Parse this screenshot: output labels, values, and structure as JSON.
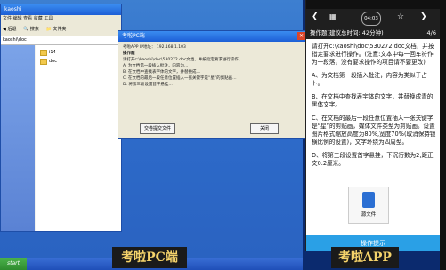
{
  "pc": {
    "explorer_title": "kaoshi",
    "menu": "文件 编辑 查看 收藏 工具",
    "toolbar_back": "后退",
    "toolbar_search": "搜索",
    "toolbar_folders": "文件夹",
    "address": "kaoshi\\doc",
    "files": [
      "i14",
      "doc"
    ],
    "dialog_title": "考啦PC端",
    "dialog_ip": "考啦APP IP地址：  192.168.1.103",
    "dialog_heading": "操作题",
    "dialog_lines": [
      "请打开c:\\kaoshi\\doc\\530272.doc文档，并按指定要求进行操作。",
      "A. 为文档第一段插入批注，内容为…",
      "B. 在文档中查找表字体的文字，并替换成…",
      "C. 在文档的最后一段任意位置插入一张关键字是“星”的剪贴画…",
      "D. 将第三段设置首字悬挂…"
    ],
    "dialog_btn_submit": "交卷提交文件",
    "dialog_btn_close": "关闭",
    "caption": "考啦PC端"
  },
  "app": {
    "timer": "04:03",
    "page_counter": "4/6",
    "subtitle": "操作题(建议总时间: 42分钟)",
    "intro": "请打开c:\\kaoshi\\doc\\530272.doc文档，并按指定要求进行操作。(注意:文本中每一回车符作为一段落，没有要求操作的项目请不要更改)",
    "items": [
      "A、为文档第一段插入批注，内容为类似于占卜。",
      "B、在文档中查找表宇体的文字，并替换成青的黑体文字。",
      "C、在文档的最后一段任意位置插入一张关键字是“星”的剪贴画，媒体文件类型为剪贴画。设置图片格式缩放高度为80%,宽度70%(取消保持锁横比例的设置)，文字环绕为四周型。",
      "D、将第三段设置首字悬挂，下沉行数为2,距正文0.2厘米。"
    ],
    "attachment": "源文件",
    "ops_button": "操作提示",
    "caption": "考啦APP"
  }
}
